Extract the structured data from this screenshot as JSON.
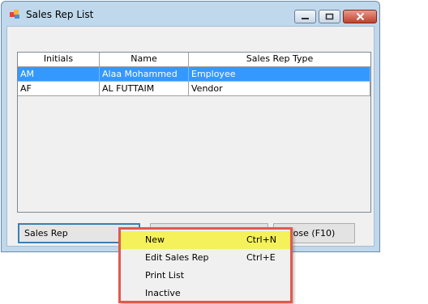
{
  "window": {
    "title": "Sales Rep List",
    "icon": "app-icon",
    "controls": [
      "minimize-icon",
      "maximize-icon",
      "close-icon"
    ]
  },
  "grid": {
    "columns": [
      "Initials",
      "Name",
      "Sales Rep Type"
    ],
    "rows": [
      {
        "initials": "AM",
        "name": "Alaa Mohammed",
        "type": "Employee",
        "selected": true
      },
      {
        "initials": "AF",
        "name": "AL FUTTAIM",
        "type": "Vendor",
        "selected": false
      }
    ]
  },
  "buttons": {
    "sales_rep": "Sales Rep",
    "close_partial": "ose (F10)"
  },
  "context_menu": {
    "items": [
      {
        "label": "New",
        "shortcut": "Ctrl+N",
        "highlighted": true
      },
      {
        "label": "Edit Sales Rep",
        "shortcut": "Ctrl+E"
      },
      {
        "label": "Print List",
        "shortcut": ""
      },
      {
        "label": "Inactive",
        "shortcut": ""
      }
    ]
  },
  "colors": {
    "selection": "#3399ff",
    "highlight": "#f4f15b",
    "annotation_border": "#e05a4e",
    "window_frame": "#bfd8ec"
  }
}
